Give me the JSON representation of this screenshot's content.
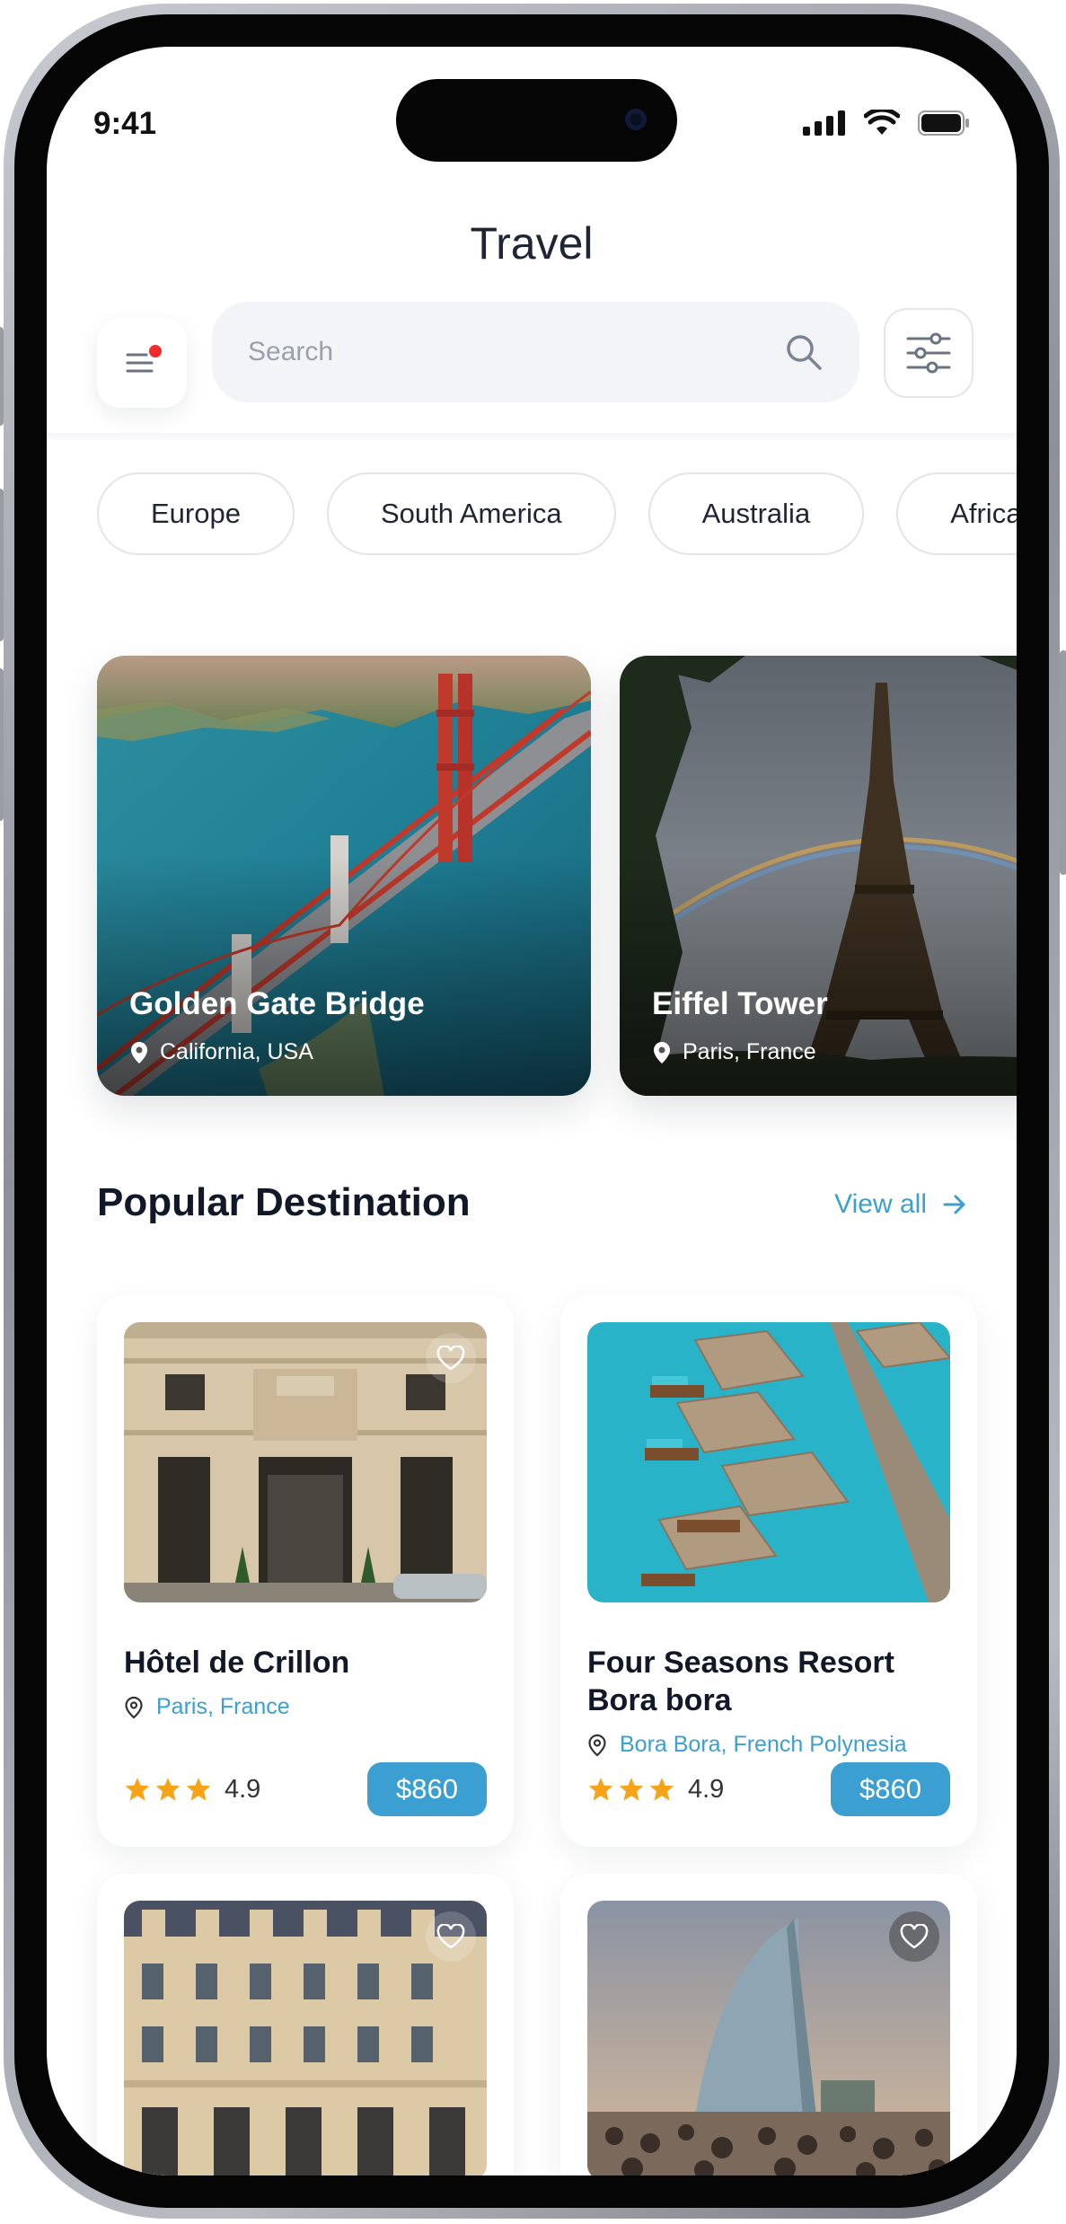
{
  "status": {
    "time": "9:41"
  },
  "header": {
    "title": "Travel"
  },
  "search": {
    "placeholder": "Search"
  },
  "regions": [
    "Europe",
    "South America",
    "Australia",
    "Africa"
  ],
  "featured": [
    {
      "name": "Golden Gate Bridge",
      "location": "California, USA"
    },
    {
      "name": "Eiffel Tower",
      "location": "Paris, France"
    }
  ],
  "popular": {
    "title": "Popular Destination",
    "view_all": "View all",
    "items": [
      {
        "name": "Hôtel de Crillon",
        "location": "Paris, France",
        "rating": "4.9",
        "price": "$860",
        "stars": 3
      },
      {
        "name": "Four Seasons Resort Bora bora",
        "location": "Bora Bora, French Polynesia",
        "rating": "4.9",
        "price": "$860",
        "stars": 3
      }
    ]
  },
  "colors": {
    "accent": "#3c9fd1",
    "notification_dot": "#ef2b2b",
    "star": "#f6a317"
  }
}
